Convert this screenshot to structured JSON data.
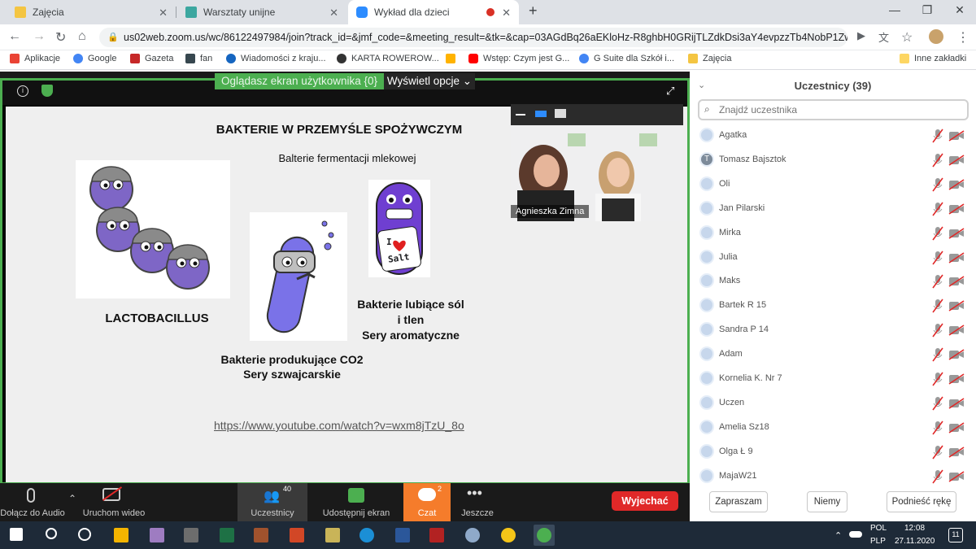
{
  "browser": {
    "tabs": [
      {
        "label": "Zajęcia",
        "color": "#f4c542"
      },
      {
        "label": "Warsztaty unijne",
        "color": "#3ca7a0"
      },
      {
        "label": "Wykład dla dzieci",
        "color": "#2d8cff",
        "active": true
      }
    ],
    "url": "us02web.zoom.us/wc/86122497984/join?track_id=&jmf_code=&meeting_result=&tk=&cap=03AGdBq26aEKloHz-R8ghbH0GRijTLZdkDsi3aY4evpzzTb4NobP1Zw...",
    "bookmarks": [
      "Aplikacje",
      "Google",
      "Gazeta",
      "fan",
      "Wiadomości z kraju...",
      "KARTA ROWEROW...",
      "Wstęp: Czym jest G...",
      "G Suite dla Szkół i...",
      "Zajęcia"
    ],
    "other_bookmarks": "Inne zakładki"
  },
  "zoom": {
    "view_badge": "Oglądasz ekran użytkownika {0}",
    "view_options": "Wyświetl opcje",
    "slide": {
      "title": "BAKTERIE W PRZEMYŚLE SPOŻYWCZYM",
      "subtitle": "Balterie fermentacji mlekowej",
      "lacto": "LACTOBACILLUS",
      "co2_line1": "Bakterie produkujące CO2",
      "co2_line2": "Sery szwajcarskie",
      "salt_line1": "Bakterie lubiące sól",
      "salt_line2": "i tlen",
      "salt_line3": "Sery aromatyczne",
      "salt_badge_i": "I",
      "salt_badge_word": "Salt",
      "link": "https://www.youtube.com/watch?v=wxm8jTzU_8o"
    },
    "video_name": "Agnieszka Zimna",
    "panel": {
      "title": "Uczestnicy (39)",
      "search_placeholder": "Znajdź uczestnika",
      "participants": [
        "Agatka",
        "Tomasz Bajsztok",
        "Oli",
        "Jan Pilarski",
        "Mirka",
        "Julia",
        "Maks",
        "Bartek R 15",
        "Sandra P 14",
        "Adam",
        "Kornelia K. Nr 7",
        "Uczen",
        "Amelia Sz18",
        "Olga Ł 9",
        "MajaW21"
      ],
      "buttons": [
        "Zapraszam",
        "Niemy",
        "Podnieść rękę"
      ]
    },
    "toolbar": {
      "audio": "Dołącz do Audio",
      "video": "Uruchom wideo",
      "participants": "Uczestnicy",
      "participants_count": "40",
      "share": "Udostępnij ekran",
      "chat": "Czat",
      "chat_count": "2",
      "more": "Jeszcze",
      "leave": "Wyjechać"
    }
  },
  "taskbar": {
    "lang1": "POL",
    "lang2": "PLP",
    "time": "12:08",
    "date": "27.11.2020",
    "notif": "11"
  }
}
